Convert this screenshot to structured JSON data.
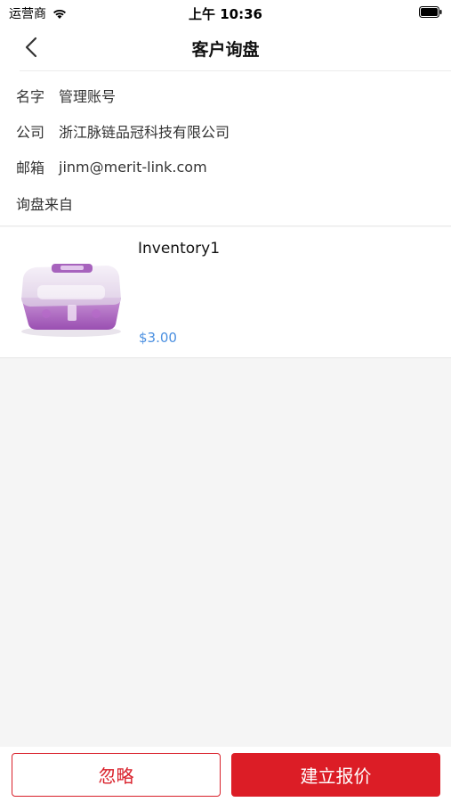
{
  "status_bar": {
    "carrier": "运营商",
    "time": "上午 10:36",
    "wifi_icon": "wifi-icon",
    "battery_icon": "battery-icon"
  },
  "nav": {
    "title": "客户询盘",
    "back_icon": "chevron-left-icon"
  },
  "customer": {
    "name_label": "名字",
    "name_value": "管理账号",
    "company_label": "公司",
    "company_value": "浙江脉链品冠科技有限公司",
    "email_label": "邮箱",
    "email_value": "jinm@merit-link.com",
    "source_label": "询盘来自",
    "source_value": ""
  },
  "product": {
    "name": "Inventory1",
    "price": "$3.00",
    "image_icon": "product-box-image"
  },
  "footer": {
    "ignore_label": "忽略",
    "quote_label": "建立报价"
  },
  "colors": {
    "accent_red": "#dc1d26",
    "price_blue": "#4a8fe0",
    "background": "#f5f5f5"
  }
}
